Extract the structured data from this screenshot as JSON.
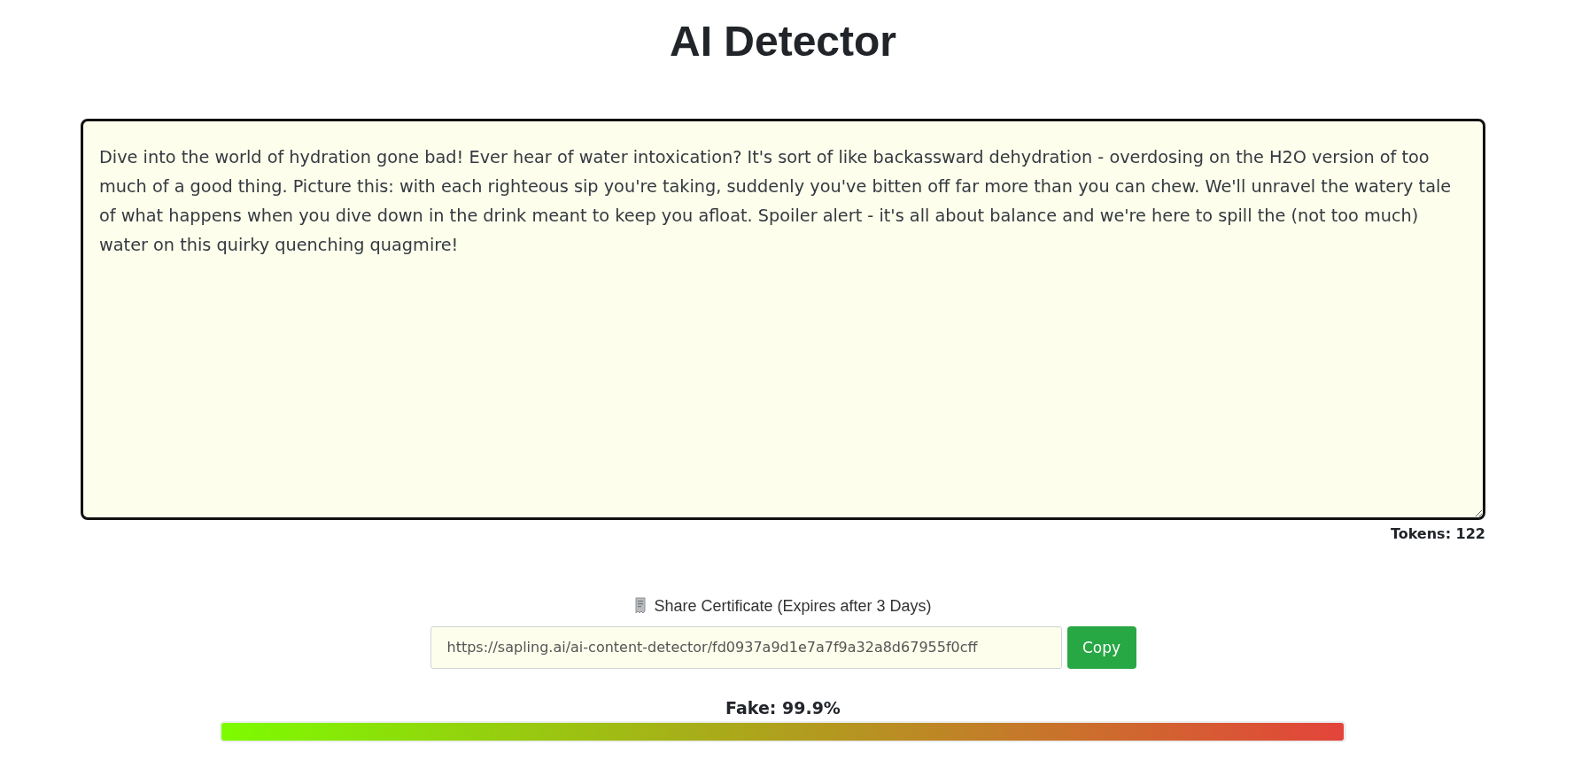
{
  "page": {
    "title": "AI Detector"
  },
  "editor": {
    "value": "Dive into the world of hydration gone bad! Ever hear of water intoxication? It's sort of like backassward dehydration - overdosing on the H2O version of too much of a good thing. Picture this: with each righteous sip you're taking, suddenly you've bitten off far more than you can chew. We'll unravel the watery tale of what happens when you dive down in the drink meant to keep you afloat. Spoiler alert - it's all about balance and we're here to spill the (not too much) water on this quirky quenching quagmire!",
    "tokens": "Tokens: 122"
  },
  "share": {
    "label": "Share Certificate (Expires after 3 Days)",
    "url": "https://sapling.ai/ai-content-detector/fd0937a9d1e7a7f9a32a8d67955f0cff",
    "button": "Copy"
  },
  "result": {
    "label": "Fake: 99.9%",
    "level": 0.999
  }
}
